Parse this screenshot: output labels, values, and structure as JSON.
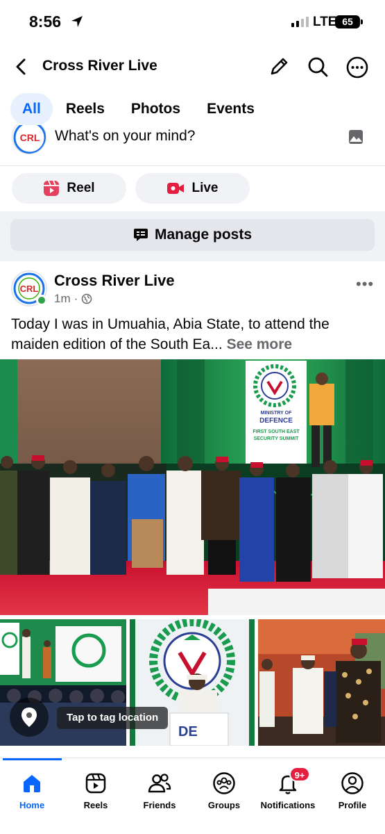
{
  "status_bar": {
    "time": "8:56",
    "network": "LTE",
    "battery": "65"
  },
  "header": {
    "title": "Cross River Live",
    "back_icon": "chevron-left-icon",
    "icons": [
      "pencil-icon",
      "search-icon",
      "more-icon"
    ]
  },
  "tabs": [
    {
      "label": "All",
      "active": true
    },
    {
      "label": "Reels",
      "active": false
    },
    {
      "label": "Photos",
      "active": false
    },
    {
      "label": "Events",
      "active": false
    }
  ],
  "composer": {
    "placeholder": "What's on your mind?",
    "avatar_logo": "CRL"
  },
  "actions": {
    "reel_label": "Reel",
    "live_label": "Live"
  },
  "manage_posts": {
    "label": "Manage posts"
  },
  "post": {
    "author": "Cross River Live",
    "avatar_logo": "CRL",
    "time": "1m",
    "privacy_icon": "globe-icon",
    "text": "Today I was in Umuahia, Abia State, to attend the maiden edition of the South Ea...",
    "see_more": "See more",
    "banner": {
      "line1": "MINISTRY OF",
      "line2": "DEFENCE",
      "line3": "FIRST SOUTH EAST",
      "line4": "SECURITY SUMMIT"
    },
    "thumb_podium_text": "DE",
    "tag_location_label": "Tap to tag location"
  },
  "bottom_nav": [
    {
      "label": "Home",
      "icon": "home-icon",
      "active": true
    },
    {
      "label": "Reels",
      "icon": "reels-icon",
      "active": false
    },
    {
      "label": "Friends",
      "icon": "friends-icon",
      "active": false
    },
    {
      "label": "Groups",
      "icon": "groups-icon",
      "active": false
    },
    {
      "label": "Notifications",
      "icon": "bell-icon",
      "active": false,
      "badge": "9+"
    },
    {
      "label": "Profile",
      "icon": "profile-icon",
      "active": false
    }
  ],
  "colors": {
    "accent": "#0866ff",
    "badge": "#e41e3f",
    "online": "#31a24c",
    "reel": "#e4405f",
    "live": "#e41e3f"
  }
}
